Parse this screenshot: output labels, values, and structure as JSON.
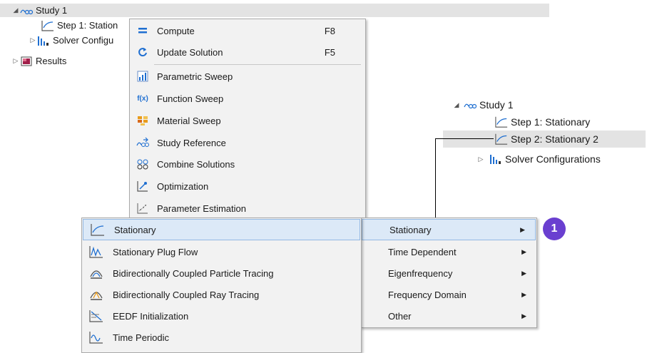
{
  "tree_left": {
    "study": "Study 1",
    "step1": "Step 1: Station",
    "solver": "Solver Configu",
    "results": "Results"
  },
  "context_menu": {
    "compute": {
      "label": "Compute",
      "shortcut": "F8"
    },
    "update": {
      "label": "Update Solution",
      "shortcut": "F5"
    },
    "parametric_sweep": "Parametric Sweep",
    "function_sweep": "Function Sweep",
    "material_sweep": "Material Sweep",
    "study_reference": "Study Reference",
    "combine_solutions": "Combine Solutions",
    "optimization": "Optimization",
    "parameter_estimation": "Parameter Estimation",
    "function_icon_text": "f(x)"
  },
  "study_types_menu": {
    "items": [
      "Stationary",
      "Time Dependent",
      "Eigenfrequency",
      "Frequency Domain",
      "Other"
    ]
  },
  "stationary_menu": {
    "items": [
      "Stationary",
      "Stationary Plug Flow",
      "Bidirectionally Coupled Particle Tracing",
      "Bidirectionally Coupled Ray Tracing",
      "EEDF Initialization",
      "Time Periodic"
    ]
  },
  "tree_right": {
    "study": "Study 1",
    "step1": "Step 1: Stationary",
    "step2": "Step 2: Stationary 2",
    "solver": "Solver Configurations"
  },
  "callout": {
    "label": "1",
    "color": "#6a3fd0"
  },
  "colors": {
    "highlight": "#dce9f7",
    "selected_row": "#e3e3e3",
    "accent_blue": "#1f6fd1"
  }
}
